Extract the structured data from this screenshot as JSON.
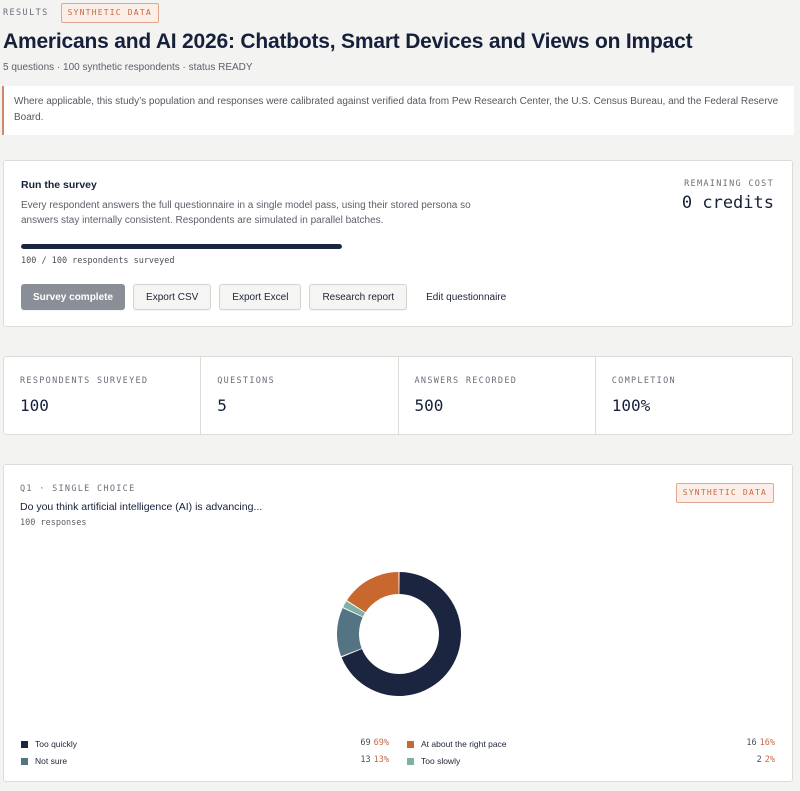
{
  "header": {
    "eyebrow": "RESULTS",
    "badge": "SYNTHETIC DATA",
    "title": "Americans and AI 2026: Chatbots, Smart Devices and Views on Impact",
    "meta": "5 questions · 100 synthetic respondents · status READY"
  },
  "notice": "Where applicable, this study’s population and responses were calibrated against verified data from Pew Research Center, the U.S. Census Bureau, and the Federal Reserve Board.",
  "run": {
    "title": "Run the survey",
    "description": "Every respondent answers the full questionnaire in a single model pass, using their stored persona so answers stay internally consistent. Respondents are simulated in parallel batches.",
    "cost_label": "REMAINING COST",
    "cost_value": "0 credits",
    "progress_fraction": 1.0,
    "progress_text": "100 / 100 respondents surveyed",
    "buttons": {
      "survey_complete": "Survey complete",
      "export_csv": "Export CSV",
      "export_excel": "Export Excel",
      "research_report": "Research report",
      "edit_questionnaire": "Edit questionnaire"
    }
  },
  "stats": [
    {
      "label": "RESPONDENTS SURVEYED",
      "value": "100"
    },
    {
      "label": "QUESTIONS",
      "value": "5"
    },
    {
      "label": "ANSWERS RECORDED",
      "value": "500"
    },
    {
      "label": "COMPLETION",
      "value": "100%"
    }
  ],
  "q1": {
    "eyebrow": "Q1 · SINGLE CHOICE",
    "text": "Do you think artificial intelligence (AI) is advancing...",
    "responses": "100 responses",
    "badge": "SYNTHETIC DATA"
  },
  "chart_data": {
    "type": "pie",
    "donut": true,
    "categories": [
      "Too quickly",
      "At about the right pace",
      "Not sure",
      "Too slowly"
    ],
    "values": [
      69,
      16,
      13,
      2
    ],
    "percent_labels": [
      "69%",
      "16%",
      "13%",
      "2%"
    ],
    "colors": [
      "#1b2540",
      "#c9682e",
      "#547383",
      "#7fb0a6"
    ]
  },
  "colors": {
    "accent": "#c86a45",
    "navy": "#1b2540"
  }
}
